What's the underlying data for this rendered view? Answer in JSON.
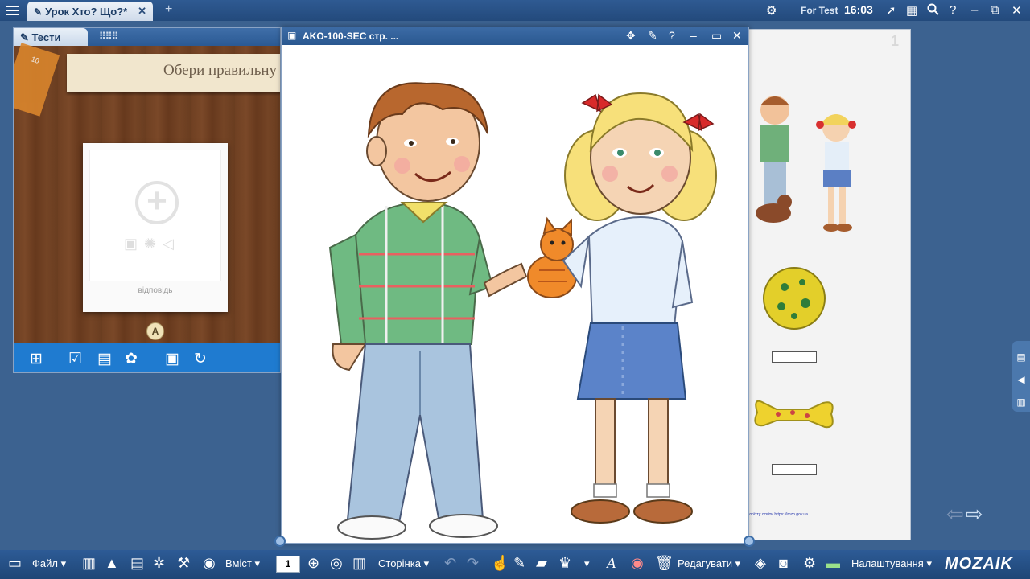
{
  "topbar": {
    "tab_title": "Урок Хто? Що?*",
    "tab_close": "✕",
    "new_tab": "+",
    "account_label": "For Test",
    "time": "16:03",
    "icons": [
      "settings-gear-icon",
      "rocket-icon",
      "apps-grid-icon",
      "search-icon",
      "help-icon",
      "minimize-icon",
      "restore-icon",
      "close-icon"
    ]
  },
  "tests_window": {
    "tab_label": "Тести",
    "instruction": "Обери правильну",
    "card_label": "відповідь",
    "badge": "A",
    "toolbar_icons": [
      "add-page-icon",
      "check-icon",
      "layout-icon",
      "palette-icon",
      "save-icon",
      "undo-icon"
    ]
  },
  "image_window": {
    "title": "AKO-100-SEC стр. ...",
    "controls": [
      "share-icon",
      "pin-icon",
      "help-icon",
      "minimize-icon",
      "maximize-icon",
      "close-icon"
    ]
  },
  "page": {
    "page_number": "1",
    "footer_link": "лоїхту освіти https://imzo.gov.ua"
  },
  "bottombar": {
    "file_menu": "Файл",
    "content_menu": "Вміст",
    "page_number": "1",
    "page_menu": "Сторінка",
    "edit_menu": "Редагувати",
    "settings_menu": "Налаштування",
    "logo": "MOZAIK",
    "dropdown": "▾"
  },
  "colors": {
    "topbar": "#2f5a92",
    "workspace": "#3c6290",
    "tests_toolbar": "#1f7bd0",
    "wood": "#6f4022"
  }
}
